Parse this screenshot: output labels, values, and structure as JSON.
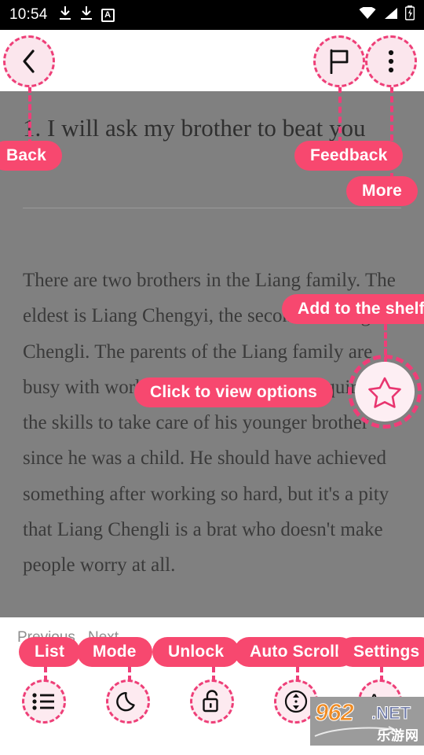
{
  "statusbar": {
    "time": "10:54",
    "icons": [
      "download-icon",
      "download-icon",
      "app-a-icon"
    ],
    "right_icons": [
      "wifi-icon",
      "signal-icon",
      "battery-charging-icon"
    ],
    "app_badge_letter": "A"
  },
  "topbar": {
    "back_icon": "chevron-left-icon",
    "feedback_icon": "flag-icon",
    "more_icon": "dots-vertical-icon"
  },
  "reader": {
    "chapter_title": "1. I will ask my brother to beat you",
    "body": "There are two brothers in the Liang family. The eldest is Liang Chengyi, the second is Liang Chengli. The parents of the Liang family are busy with work. Liang Chengyi has acquired the skills to take care of his younger brother since he was a child. He should have achieved something after working so hard, but it's a pity that Liang Chengli is a brat who doesn't make people worry at all."
  },
  "callouts": {
    "back": "Back",
    "feedback": "Feedback",
    "more": "More",
    "add_to_shelf": "Add to the shelf",
    "click_options": "Click to view options",
    "list": "List",
    "mode": "Mode",
    "unlock": "Unlock",
    "auto_scroll": "Auto Scroll",
    "settings": "Settings"
  },
  "bottombar": {
    "previous": "Previous",
    "next": "Next",
    "tools": [
      {
        "name": "list",
        "icon": "list-icon"
      },
      {
        "name": "mode",
        "icon": "moon-icon"
      },
      {
        "name": "unlock",
        "icon": "unlock-icon"
      },
      {
        "name": "auto_scroll",
        "icon": "auto-scroll-icon"
      },
      {
        "name": "settings",
        "icon": "font-size-aa-icon"
      }
    ],
    "aa_label": "Aa"
  },
  "fab": {
    "icon": "star-outline-icon"
  },
  "watermark": {
    "number": "962",
    "tld": ".NET",
    "cn": "乐游网"
  },
  "colors": {
    "accent_pink": "#f7486f",
    "dash_pink": "#ee3f78",
    "pale_pink": "#fbe6ed",
    "dim_overlay": "#808080",
    "status_bg": "#000000"
  }
}
